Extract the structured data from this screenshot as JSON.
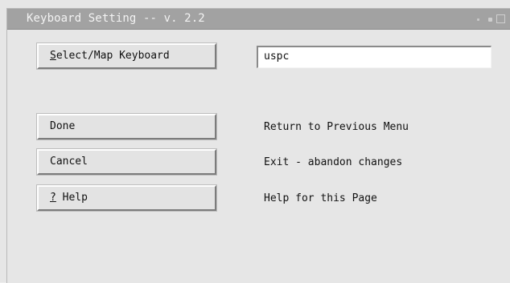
{
  "window": {
    "title": "Keyboard Setting -- v. 2.2"
  },
  "keyboard": {
    "select_button": {
      "mnemonic": "S",
      "rest": "elect/Map Keyboard"
    },
    "value": "uspc"
  },
  "actions": [
    {
      "id": "done",
      "mnemonic": "",
      "label": "Done",
      "description": "Return to Previous Menu"
    },
    {
      "id": "cancel",
      "mnemonic": "",
      "label": "Cancel",
      "description": "Exit - abandon changes"
    },
    {
      "id": "help",
      "mnemonic": "?",
      "label": " Help",
      "description": "Help for this Page"
    }
  ],
  "colors": {
    "titlebar": "#a2a2a2",
    "background": "#e6e6e6",
    "field": "#ffffff"
  }
}
